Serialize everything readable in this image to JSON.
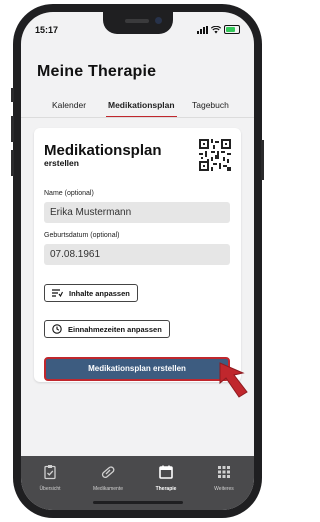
{
  "status": {
    "time": "15:17"
  },
  "page": {
    "title": "Meine Therapie"
  },
  "tabs": [
    {
      "label": "Kalender"
    },
    {
      "label": "Medikationsplan"
    },
    {
      "label": "Tagebuch"
    }
  ],
  "card": {
    "title": "Medikationsplan",
    "subtitle": "erstellen",
    "name_label": "Name (optional)",
    "name_value": "Erika Mustermann",
    "dob_label": "Geburtsdatum (optional)",
    "dob_value": "07.08.1961",
    "customize_label": "Inhalte anpassen",
    "times_label": "Einnahmezeiten anpassen",
    "create_label": "Medikationsplan erstellen"
  },
  "nav": [
    {
      "label": "Übersicht",
      "icon": "clipboard-icon"
    },
    {
      "label": "Medikamente",
      "icon": "pill-icon"
    },
    {
      "label": "Therapie",
      "icon": "calendar-icon"
    },
    {
      "label": "Weiteres",
      "icon": "grid-icon"
    }
  ],
  "colors": {
    "accent": "#c0272d",
    "primary": "#3d5c80",
    "nav_bg": "#4a4a4c"
  }
}
